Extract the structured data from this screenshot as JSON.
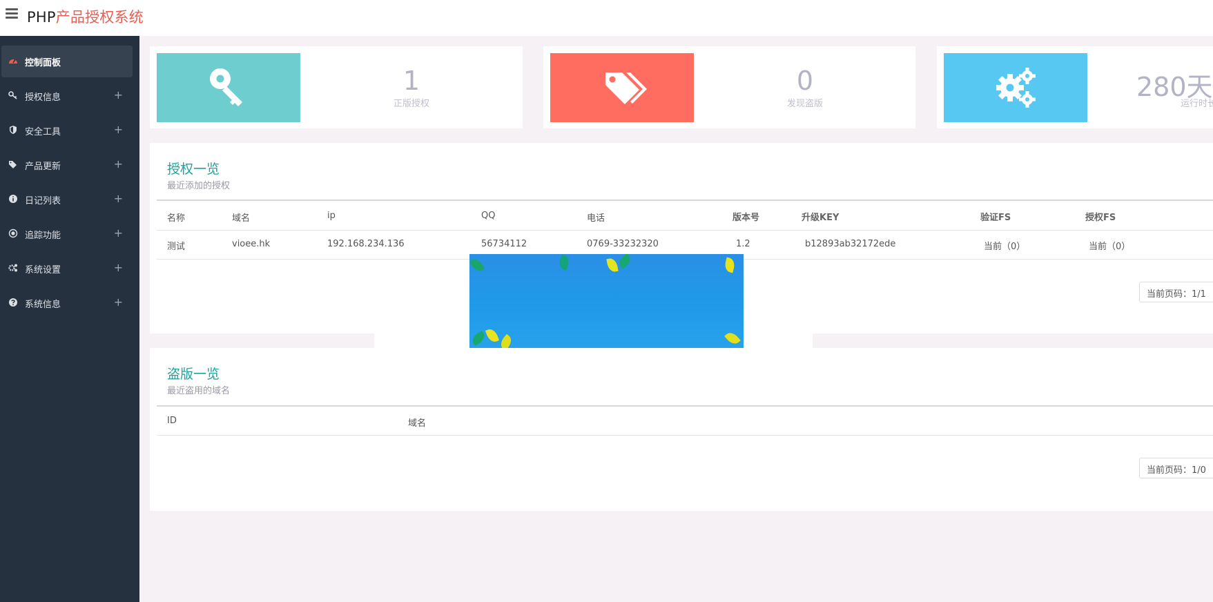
{
  "header": {
    "brand_prefix": "PHP",
    "brand_suffix": "产品授权系统"
  },
  "sidebar": {
    "items": [
      {
        "label": "控制面板",
        "icon": "dashboard-icon",
        "active": true
      },
      {
        "label": "授权信息",
        "icon": "key-icon",
        "plus": "+"
      },
      {
        "label": "安全工具",
        "icon": "shield-icon",
        "plus": "+"
      },
      {
        "label": "产品更新",
        "icon": "tags-icon",
        "plus": "+"
      },
      {
        "label": "日记列表",
        "icon": "info-icon",
        "plus": "+"
      },
      {
        "label": "追踪功能",
        "icon": "target-icon",
        "plus": "+"
      },
      {
        "label": "系统设置",
        "icon": "gears-icon",
        "plus": "+"
      },
      {
        "label": "系统信息",
        "icon": "question-icon",
        "plus": "+"
      }
    ]
  },
  "stats": [
    {
      "value": "1",
      "label": "正版授权",
      "icon": "key-icon",
      "color": "#6ecdcf"
    },
    {
      "value": "0",
      "label": "发现盗版",
      "icon": "tags-icon",
      "color": "#ff6c60"
    },
    {
      "value": "280天",
      "label": "运行时长",
      "icon": "gears-icon",
      "color": "#57c8f2"
    }
  ],
  "auth_section": {
    "title": "授权一览",
    "subtitle": "最近添加的授权",
    "columns": [
      "名称",
      "域名",
      "ip",
      "QQ",
      "电话",
      "版本号",
      "升级KEY",
      "验证FS",
      "授权FS"
    ],
    "rows": [
      [
        "测试",
        "vioee.hk",
        "192.168.234.136",
        "56734112",
        "0769-33232320",
        "1.2",
        "b12893ab32172ede",
        "当前（0）",
        "当前（0）"
      ]
    ],
    "pager": "当前页码：1/1"
  },
  "piracy_section": {
    "title": "盗版一览",
    "subtitle": "最近盗用的域名",
    "columns": [
      "ID",
      "域名"
    ],
    "pager": "当前页码：1/0"
  },
  "colors": {
    "accent": "#1fa3a0",
    "brand_red": "#ef5b4f",
    "sidebar_bg": "#26313f"
  }
}
